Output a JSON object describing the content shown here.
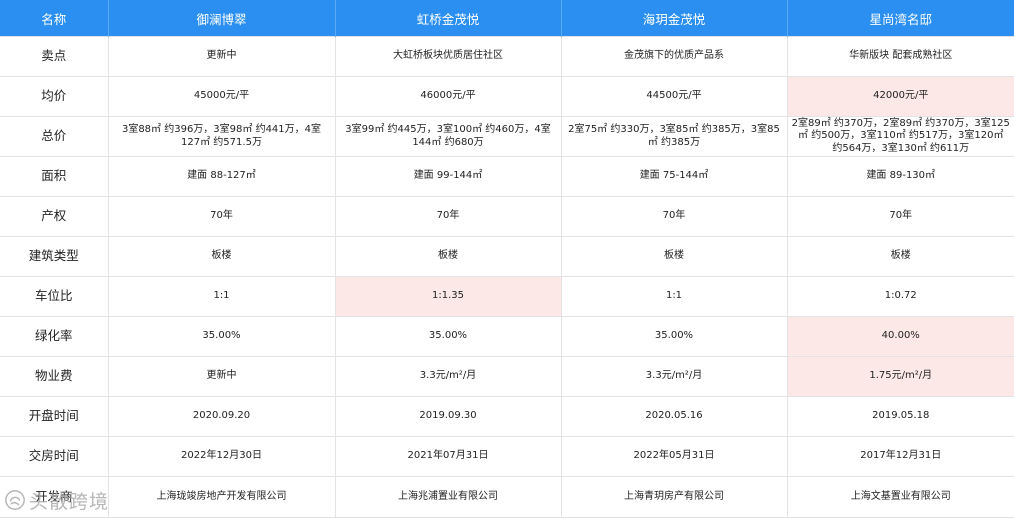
{
  "table": {
    "headers": [
      "名称",
      "御澜博翠",
      "虹桥金茂悦",
      "海玥金茂悦",
      "星尚湾名邸"
    ],
    "rows": [
      {
        "label": "卖点",
        "cells": [
          "更新中",
          "大虹桥板块优质居住社区",
          "金茂旗下的优质产品系",
          "华新版块 配套成熟社区"
        ],
        "highlight": [
          false,
          false,
          false,
          false
        ]
      },
      {
        "label": "均价",
        "cells": [
          "45000元/平",
          "46000元/平",
          "44500元/平",
          "42000元/平"
        ],
        "highlight": [
          false,
          false,
          false,
          true
        ]
      },
      {
        "label": "总价",
        "cells": [
          "3室88㎡ 约396万，3室98㎡ 约441万，4室127㎡ 约571.5万",
          "3室99㎡ 约445万，3室100㎡ 约460万，4室144㎡ 约680万",
          "2室75㎡ 约330万，3室85㎡ 约385万，3室85㎡ 约385万",
          "2室89㎡ 约370万，2室89㎡ 约370万，3室125㎡ 约500万，3室110㎡ 约517万，3室120㎡ 约564万，3室130㎡ 约611万"
        ],
        "highlight": [
          false,
          false,
          false,
          false
        ]
      },
      {
        "label": "面积",
        "cells": [
          "建面 88-127㎡",
          "建面 99-144㎡",
          "建面 75-144㎡",
          "建面 89-130㎡"
        ],
        "highlight": [
          false,
          false,
          false,
          false
        ]
      },
      {
        "label": "产权",
        "cells": [
          "70年",
          "70年",
          "70年",
          "70年"
        ],
        "highlight": [
          false,
          false,
          false,
          false
        ]
      },
      {
        "label": "建筑类型",
        "cells": [
          "板楼",
          "板楼",
          "板楼",
          "板楼"
        ],
        "highlight": [
          false,
          false,
          false,
          false
        ]
      },
      {
        "label": "车位比",
        "cells": [
          "1:1",
          "1:1.35",
          "1:1",
          "1:0.72"
        ],
        "highlight": [
          false,
          true,
          false,
          false
        ]
      },
      {
        "label": "绿化率",
        "cells": [
          "35.00%",
          "35.00%",
          "35.00%",
          "40.00%"
        ],
        "highlight": [
          false,
          false,
          false,
          true
        ]
      },
      {
        "label": "物业费",
        "cells": [
          "更新中",
          "3.3元/m²/月",
          "3.3元/m²/月",
          "1.75元/m²/月"
        ],
        "highlight": [
          false,
          false,
          false,
          true
        ]
      },
      {
        "label": "开盘时间",
        "cells": [
          "2020.09.20",
          "2019.09.30",
          "2020.05.16",
          "2019.05.18"
        ],
        "highlight": [
          false,
          false,
          false,
          false
        ]
      },
      {
        "label": "交房时间",
        "cells": [
          "2022年12月30日",
          "2021年07月31日",
          "2022年05月31日",
          "2017年12月31日"
        ],
        "highlight": [
          false,
          false,
          false,
          false
        ]
      },
      {
        "label": "开发商",
        "cells": [
          "上海珑竣房地产开发有限公司",
          "上海兆浦置业有限公司",
          "上海青玥房产有限公司",
          "上海文基置业有限公司"
        ],
        "highlight": [
          false,
          false,
          false,
          false
        ]
      }
    ]
  },
  "watermark": {
    "text": "头散跨境",
    "icon": "watermark-logo-icon"
  },
  "colors": {
    "header_bg": "#2b8ff2",
    "header_text": "#ffffff",
    "highlight_bg": "#fde8e8",
    "border": "#e3e3e3"
  }
}
